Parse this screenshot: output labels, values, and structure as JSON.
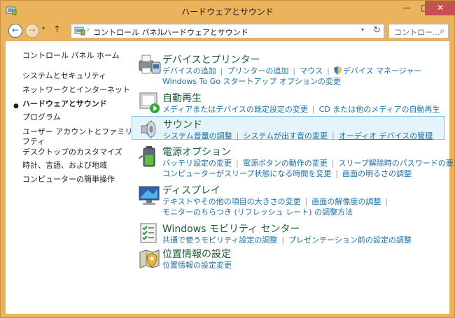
{
  "window": {
    "title": "ハードウェアとサウンド",
    "minimize": "—",
    "maximize": "□",
    "close": "✕"
  },
  "nav": {
    "back": "←",
    "forward": "→",
    "dropdown": "▾",
    "up": "↑",
    "breadcrumbs": [
      "コントロール パネル",
      "ハードウェアとサウンド"
    ],
    "crumb_sep": "›",
    "address_dropdown": "▾",
    "refresh": "↻",
    "search_placeholder": "コントロー...",
    "search_glyph": "⌕"
  },
  "sidebar": {
    "items": [
      {
        "label": "コントロール パネル ホーム"
      },
      {
        "label": "システムとセキュリティ"
      },
      {
        "label": "ネットワークとインターネット"
      },
      {
        "label": "ハードウェアとサウンド",
        "current": true
      },
      {
        "label": "プログラム"
      },
      {
        "label": "ユーザー アカウントとファミリー セー"
      },
      {
        "label": "フティ"
      },
      {
        "label": "デスクトップのカスタマイズ"
      },
      {
        "label": "時計、言語、および地域"
      },
      {
        "label": "コンピューターの簡単操作"
      }
    ],
    "bullet": "●"
  },
  "categories": [
    {
      "title": "デバイスとプリンター",
      "icon": "printer-icon",
      "lines": [
        [
          "デバイスの追加",
          "プリンターの追加",
          "マウス",
          "デバイス マネージャー"
        ],
        [
          "Windows To Go スタートアップ オプションの変更"
        ]
      ]
    },
    {
      "title": "自動再生",
      "icon": "autoplay-icon",
      "lines": [
        [
          "メディアまたはデバイスの既定設定の変更",
          "CD または他のメディアの自動再生"
        ]
      ]
    },
    {
      "title": "サウンド",
      "icon": "speaker-icon",
      "lines": [
        [
          "システム音量の調整",
          "システムが出す音の変更",
          "オーディオ デバイスの管理"
        ]
      ]
    },
    {
      "title": "電源オプション",
      "icon": "battery-icon",
      "lines": [
        [
          "バッテリ設定の変更",
          "電源ボタンの動作の変更",
          "スリープ解除時のパスワードの要求"
        ],
        [
          "コンピューターがスリープ状態になる時間を変更",
          "画面の明るさの調整"
        ]
      ]
    },
    {
      "title": "ディスプレイ",
      "icon": "display-icon",
      "lines": [
        [
          "テキストやその他の項目の大きさの変更",
          "画面の解像度の調整"
        ],
        [
          "モニターのちらつき (リフレッシュ レート) の調整方法"
        ]
      ]
    },
    {
      "title": "Windows モビリティ センター",
      "icon": "mobility-center-icon",
      "lines": [
        [
          "共通で使うモビリティ設定の調整",
          "プレゼンテーション前の設定の調整"
        ]
      ]
    },
    {
      "title": "位置情報の設定",
      "icon": "location-icon",
      "lines": [
        [
          "位置情報の設定変更"
        ]
      ]
    }
  ],
  "colors": {
    "title_bar": "#ebb35c",
    "category_title": "#1b5c38",
    "link": "#1d6fa4",
    "selected_bg": "#e5f3fb",
    "selected_border": "#8ec5e6",
    "close_button": "#c75050"
  }
}
